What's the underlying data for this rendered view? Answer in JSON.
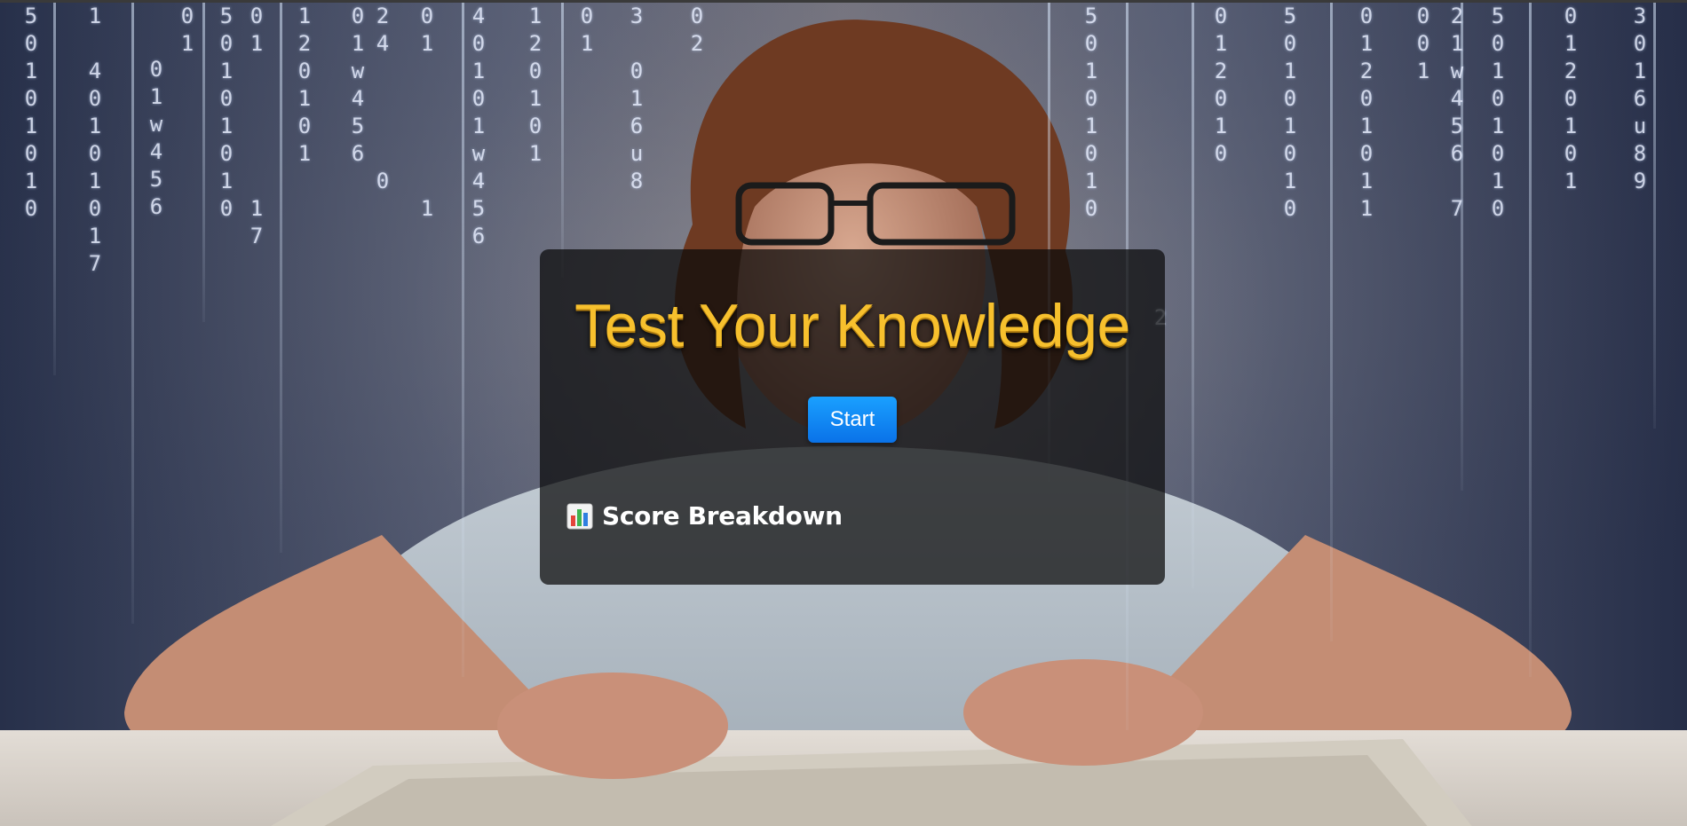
{
  "app": {
    "title": "Test Your Knowledge",
    "start_label": "Start",
    "score_heading": "Score Breakdown",
    "score_icon": "bar-chart-icon"
  },
  "colors": {
    "title": "#f7c02d",
    "button": "#0a84ff",
    "card_background": "#0a0a0a"
  },
  "background": {
    "description_icon": "person-at-keyboard-image",
    "digits": [
      "5\n0\n1\n0\n1\n0\n1\n0",
      "1\n\n4\n0\n1\n0\n1\n0\n1\n7",
      "0\n1\nw\n4\n5\n6",
      "0\n1",
      "5\n0\n1\n0\n1\n0\n1\n0",
      "0\n1\n\n\n\n\n\n1\n7",
      "1\n2\n0\n1\n0\n1",
      "0\n1\nw\n4\n5\n6",
      "2\n4\n\n\n\n\n0",
      "0\n1\n\n\n\n\n\n1",
      "4\n0\n1\n0\n1\nw\n4\n5\n6",
      "1\n2\n0\n1\n0\n1",
      "0\n1",
      "3\n\n0\n1\n6\nu\n8",
      "0\n2",
      "5\n0\n1\n0\n1\n0\n1\n0",
      "2",
      "0\n1\n2\n0\n1\n0",
      "5\n0\n1\n0\n1\n0\n1\n0",
      "0\n1\n2\n0\n1\n0\n1\n1",
      "0\n0\n1",
      "2\n1\nw\n4\n5\n6\n\n7",
      "5\n0\n1\n0\n1\n0\n1\n0",
      "0\n1\n2\n0\n1\n0\n1",
      "3\n0\n1\n6\nu\n8\n9"
    ]
  }
}
